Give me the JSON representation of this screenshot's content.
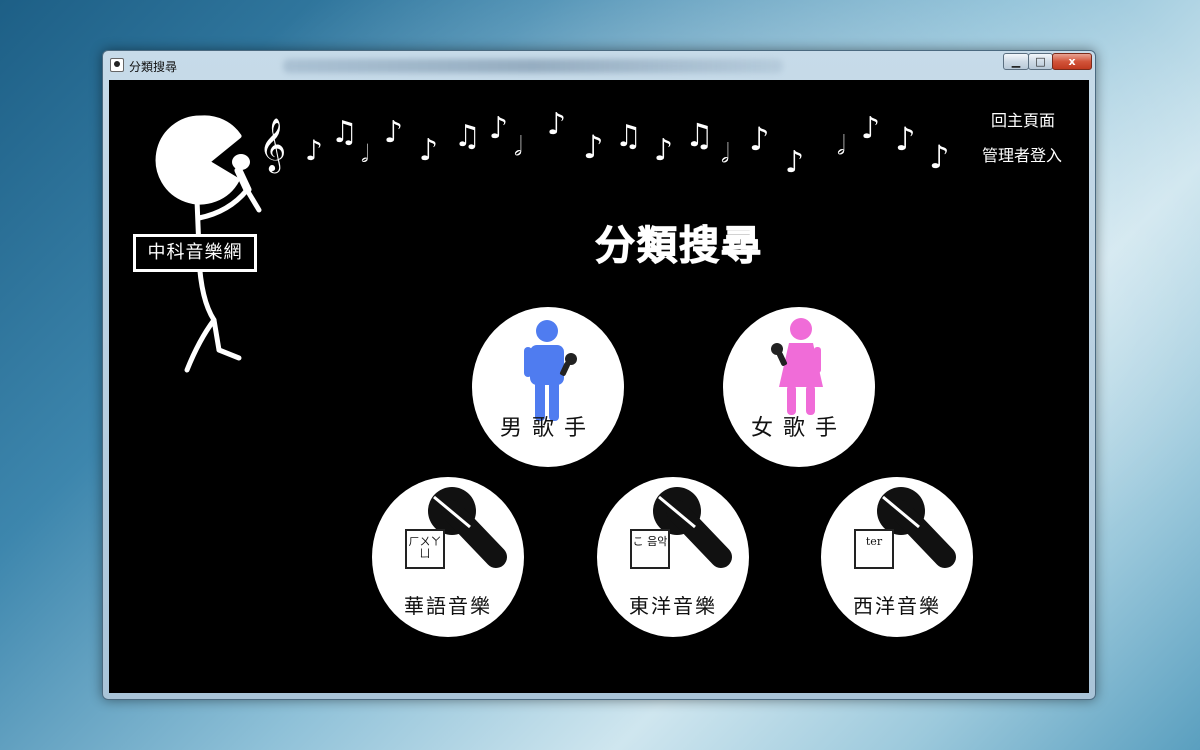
{
  "window": {
    "title": "分類搜尋",
    "controls": {
      "minimize": "▁",
      "maximize": "□",
      "close": "x"
    }
  },
  "nav": {
    "home": "回主頁面",
    "admin_login": "管理者登入"
  },
  "logo": {
    "text": "中科音樂網"
  },
  "page": {
    "heading": "分類搜尋"
  },
  "categories": {
    "male": {
      "label": "男歌手",
      "color": "#4f7cf0",
      "icon": "male-singer-icon"
    },
    "female": {
      "label": "女歌手",
      "color": "#f06cd8",
      "icon": "female-singer-icon"
    },
    "chinese": {
      "label": "華語音樂",
      "tag": "ㄏㄨㄚㄩ",
      "icon": "microphone-icon"
    },
    "japanese": {
      "label": "東洋音樂",
      "tag": "こ 음악",
      "icon": "microphone-icon"
    },
    "western": {
      "label": "西洋音樂",
      "tag": "ter",
      "icon": "microphone-icon"
    }
  },
  "colors": {
    "background": "#000000",
    "text": "#ffffff",
    "circle": "#ffffff"
  }
}
